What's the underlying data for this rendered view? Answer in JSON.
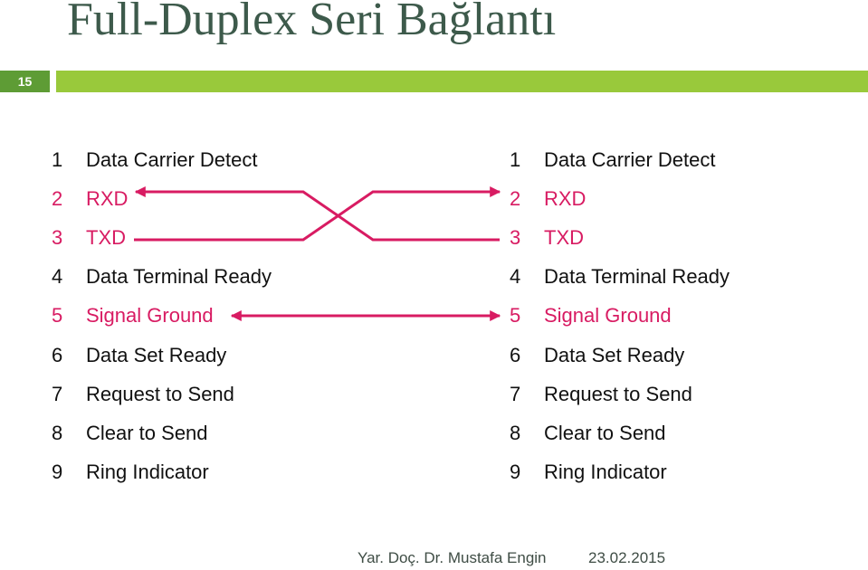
{
  "slide": {
    "title": "Full-Duplex Seri Bağlantı",
    "number": "15",
    "footer_author": "Yar. Doç. Dr. Mustafa Engin",
    "footer_date": "23.02.2015"
  },
  "colors": {
    "title": "#3d5a4b",
    "slide_number_bg": "#5e9c35",
    "header_bar": "#99c93b",
    "active_signal": "#d81b62",
    "text": "#111111"
  },
  "connector_left": {
    "pins": [
      {
        "num": "1",
        "label": "Data Carrier Detect",
        "active": false
      },
      {
        "num": "2",
        "label": "RXD",
        "active": true
      },
      {
        "num": "3",
        "label": "TXD",
        "active": true
      },
      {
        "num": "4",
        "label": "Data Terminal Ready",
        "active": false
      },
      {
        "num": "5",
        "label": "Signal Ground",
        "active": true
      },
      {
        "num": "6",
        "label": "Data Set Ready",
        "active": false
      },
      {
        "num": "7",
        "label": "Request to Send",
        "active": false
      },
      {
        "num": "8",
        "label": "Clear to Send",
        "active": false
      },
      {
        "num": "9",
        "label": "Ring Indicator",
        "active": false
      }
    ]
  },
  "connector_right": {
    "pins": [
      {
        "num": "1",
        "label": "Data Carrier Detect",
        "active": false
      },
      {
        "num": "2",
        "label": "RXD",
        "active": true
      },
      {
        "num": "3",
        "label": "TXD",
        "active": true
      },
      {
        "num": "4",
        "label": "Data Terminal Ready",
        "active": false
      },
      {
        "num": "5",
        "label": "Signal Ground",
        "active": true
      },
      {
        "num": "6",
        "label": "Data Set Ready",
        "active": false
      },
      {
        "num": "7",
        "label": "Request to Send",
        "active": false
      },
      {
        "num": "8",
        "label": "Clear to Send",
        "active": false
      },
      {
        "num": "9",
        "label": "Ring Indicator",
        "active": false
      }
    ]
  },
  "connections": [
    {
      "from": "left TXD (3)",
      "to": "right RXD (2)",
      "arrow": "right"
    },
    {
      "from": "right TXD (3)",
      "to": "left RXD (2)",
      "arrow": "left"
    },
    {
      "from": "left Signal Ground (5)",
      "to": "right Signal Ground (5)",
      "arrow": "both"
    }
  ]
}
